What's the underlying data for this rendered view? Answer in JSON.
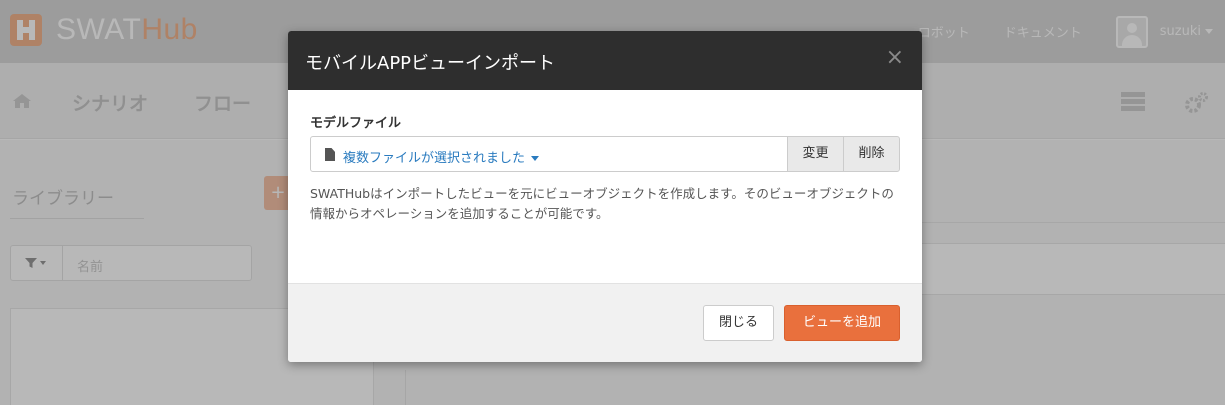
{
  "navbar": {
    "brand_main": "SWAT",
    "brand_accent": "Hub",
    "links": [
      "ロボット",
      "ドキュメント"
    ],
    "username": "suzuki"
  },
  "subnav": {
    "items": [
      "シナリオ",
      "フロー"
    ]
  },
  "library": {
    "tab_label": "ライブラリー",
    "add_label": "+",
    "filter_placeholder": "名前"
  },
  "modal": {
    "title": "モバイルAPPビューインポート",
    "close_glyph": "×",
    "field_label": "モデルファイル",
    "file_selected_text": "複数ファイルが選択されました",
    "change_button": "変更",
    "delete_button": "削除",
    "help_text": "SWATHubはインポートしたビューを元にビューオブジェクトを作成します。そのビューオブジェクトの情報からオペレーションを追加することが可能です。",
    "close_button": "閉じる",
    "add_view_button": "ビューを追加"
  },
  "colors": {
    "accent": "#e9703d",
    "link_blue": "#2a7bbf",
    "modal_header": "#2e2e2e"
  },
  "icons": [
    "home-icon",
    "file-icon",
    "filter-icon",
    "server-icon",
    "gears-icon",
    "user-avatar-icon",
    "close-icon"
  ]
}
